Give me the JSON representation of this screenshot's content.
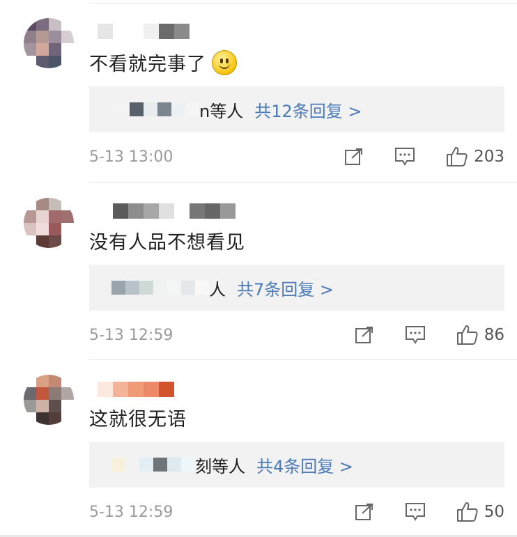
{
  "comments": [
    {
      "text": "不看就完事了",
      "emoji": "smiley",
      "reply_suffix": "n等人",
      "reply_link": "共12条回复 >",
      "time": "5-13 13:00",
      "likes": "203"
    },
    {
      "text": "没有人品不想看见",
      "reply_suffix": "人",
      "reply_link": "共7条回复 >",
      "time": "5-13 12:59",
      "likes": "86"
    },
    {
      "text": "这就很无语",
      "reply_suffix": "刻等人",
      "reply_link": "共4条回复 >",
      "time": "5-13 12:59",
      "likes": "50"
    }
  ],
  "icons": {
    "share": "share-icon",
    "comment": "comment-icon",
    "like": "thumbs-up-icon"
  },
  "colors": {
    "link": "#4a7bb8",
    "reply_bg": "#f2f2f2",
    "meta_text": "#9a9a9a"
  }
}
